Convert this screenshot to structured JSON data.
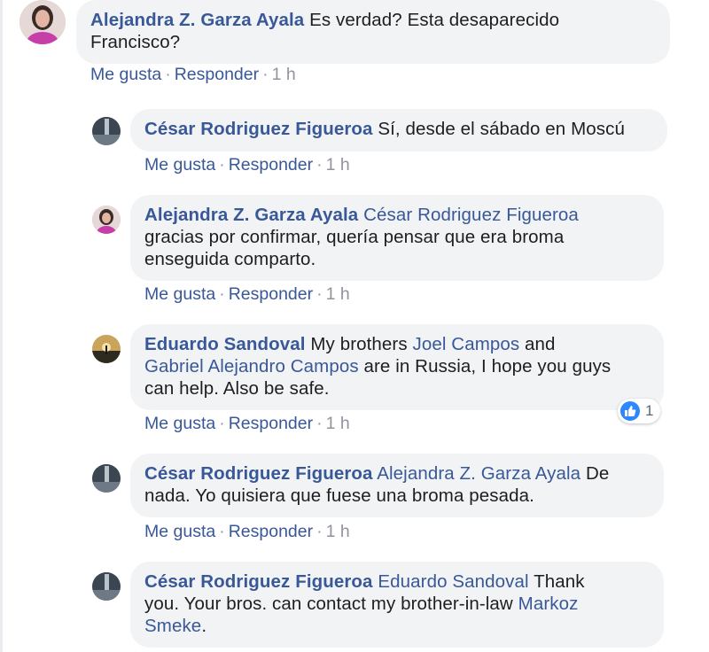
{
  "actions": {
    "like": "Me gusta",
    "reply": "Responder",
    "sep": "·",
    "time": "1 h"
  },
  "comments": [
    {
      "author": "Alejandra Z. Garza Ayala",
      "text1": "Es verdad? Esta desaparecido",
      "text2": "Francisco?"
    },
    {
      "author": "César Rodriguez Figueroa",
      "text1": "Sí, desde el sábado en Moscú"
    },
    {
      "author": "Alejandra Z. Garza Ayala",
      "mention": "César Rodriguez Figueroa",
      "text1": "gracias por confirmar, quería pensar que era broma",
      "text2": "enseguida comparto."
    },
    {
      "author": "Eduardo Sandoval",
      "text1": "My brothers",
      "mention1": "Joel Campos",
      "text2": "and",
      "mention2": "Gabriel Alejandro Campos",
      "text3": "are in Russia, I hope you guys",
      "text4": "can help. Also be safe.",
      "reaction_count": "1"
    },
    {
      "author": "César Rodriguez Figueroa",
      "mention": "Alejandra Z. Garza Ayala",
      "text1": "De",
      "text2": "nada. Yo quisiera que fuese una broma pesada."
    },
    {
      "author": "César Rodriguez Figueroa",
      "mention": "Eduardo Sandoval",
      "text1": "Thank",
      "text2": "you. Your bros. can contact my brother-in-law",
      "mention2": "Markoz",
      "mention2b": "Smeke",
      "text3": "."
    }
  ],
  "colors": {
    "link": "#385898",
    "bubble": "#f2f3f5",
    "meta": "#90949c",
    "like_blue": "#2d88ff"
  }
}
